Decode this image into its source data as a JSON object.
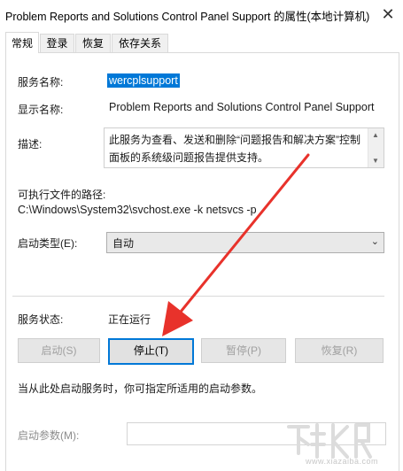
{
  "window": {
    "title": "Problem Reports and Solutions Control Panel Support 的属性(本地计算机)",
    "close_symbol": "✕"
  },
  "tabs": [
    {
      "label": "常规",
      "active": true
    },
    {
      "label": "登录",
      "active": false
    },
    {
      "label": "恢复",
      "active": false
    },
    {
      "label": "依存关系",
      "active": false
    }
  ],
  "general": {
    "service_name_label": "服务名称:",
    "service_name_value": "wercplsupport",
    "display_name_label": "显示名称:",
    "display_name_value": "Problem Reports and Solutions Control Panel Support",
    "description_label": "描述:",
    "description_value": "此服务为查看、发送和删除“问题报告和解决方案”控制面板的系统级问题报告提供支持。",
    "exec_path_label": "可执行文件的路径:",
    "exec_path_value": "C:\\Windows\\System32\\svchost.exe -k netsvcs -p",
    "startup_type_label": "启动类型(E):",
    "startup_type_value": "自动",
    "service_status_label": "服务状态:",
    "service_status_value": "正在运行",
    "buttons": {
      "start": "启动(S)",
      "stop": "停止(T)",
      "pause": "暂停(P)",
      "resume": "恢复(R)"
    },
    "hint": "当从此处启动服务时，你可指定所适用的启动参数。",
    "start_params_label": "启动参数(M):",
    "start_params_value": ""
  },
  "watermark": {
    "text": "www.xiazaiba.com"
  },
  "colors": {
    "accent": "#0078d7",
    "annotation_arrow": "#e8322b"
  }
}
